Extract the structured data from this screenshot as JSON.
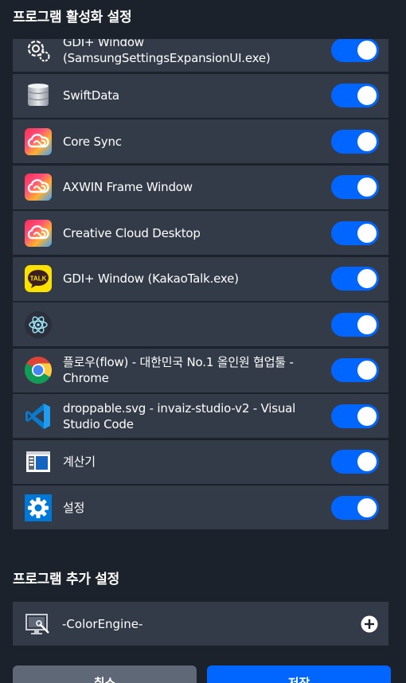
{
  "header": {
    "title": "프로그램 활성화 설정"
  },
  "programs": [
    {
      "name": "GDI+ Window (SamsungSettingsExpansionUI.exe)",
      "icon": "gear-outline-icon",
      "enabled": true
    },
    {
      "name": "SwiftData",
      "icon": "database-icon",
      "enabled": true
    },
    {
      "name": "Core Sync",
      "icon": "creative-cloud-icon",
      "enabled": true
    },
    {
      "name": "AXWIN Frame Window",
      "icon": "creative-cloud-icon",
      "enabled": true
    },
    {
      "name": "Creative Cloud Desktop",
      "icon": "creative-cloud-icon",
      "enabled": true
    },
    {
      "name": "GDI+ Window (KakaoTalk.exe)",
      "icon": "kakaotalk-icon",
      "enabled": true
    },
    {
      "name": "",
      "icon": "electron-icon",
      "enabled": true
    },
    {
      "name": "플로우(flow) - 대한민국 No.1 올인원 협업툴 - Chrome",
      "icon": "chrome-icon",
      "enabled": true
    },
    {
      "name": "droppable.svg - invaiz-studio-v2 - Visual Studio Code",
      "icon": "vscode-icon",
      "enabled": true
    },
    {
      "name": "계산기",
      "icon": "calculator-icon",
      "enabled": true
    },
    {
      "name": "설정",
      "icon": "settings-gear-icon",
      "enabled": true
    }
  ],
  "extra": {
    "title": "프로그램 추가 설정",
    "item": {
      "name": "-ColorEngine-",
      "icon": "monitor-tool-icon"
    },
    "add_icon": "plus-circle-icon"
  },
  "buttons": {
    "cancel": "취소",
    "save": "저장"
  },
  "colors": {
    "background": "#1c222c",
    "row": "#343b48",
    "accent": "#0066ff",
    "cancel": "#5f6877"
  },
  "kakao_badge": "TALK"
}
